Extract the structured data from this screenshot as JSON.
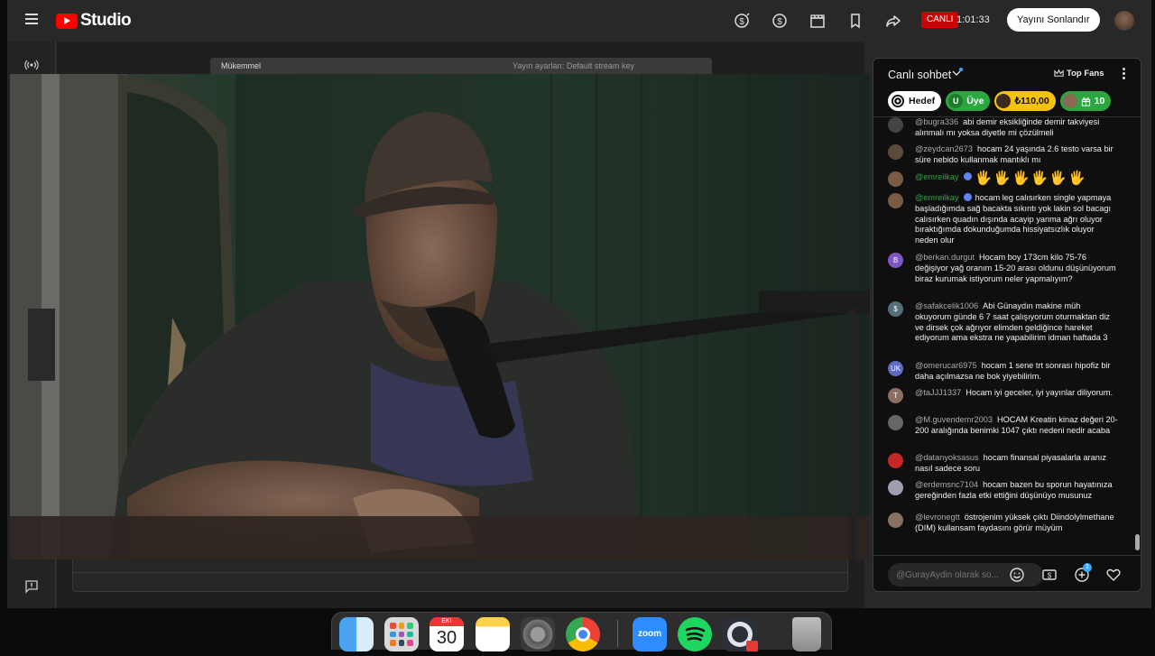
{
  "app": {
    "logo_text": "Studio"
  },
  "topbar": {
    "live_label": "CANLI",
    "live_time": "1:01:33",
    "end_stream_label": "Yayını Sonlandır",
    "icons": [
      "dollar-icon",
      "super-chat-icon",
      "clapperboard-icon",
      "bookmark-icon",
      "share-icon"
    ]
  },
  "preview": {
    "status_text": "Mükemmel",
    "encoder_text": "Yayın ayarları: Default stream key"
  },
  "chat": {
    "title": "Canlı sohbet",
    "top_fans_label": "Top Fans",
    "chips": {
      "goal": "Hedef",
      "member_initial": "U",
      "member": "Üye",
      "supers": "₺110,00",
      "gifts": "10"
    },
    "messages": [
      {
        "author": "@bugra336",
        "text": "abi demir eksikliğinde demir takviyesi alınmalı mı yoksa diyetle mi çözülmeli",
        "avatar": "",
        "avatar_color": "#444444"
      },
      {
        "author": "@zeydcan2673",
        "text": "hocam 24 yaşında 2.6 testo varsa bir süre nebido kullanmak mantıklı mı",
        "avatar": "",
        "avatar_color": "#5a4a3a"
      },
      {
        "author": "@emreilkay",
        "text": "",
        "emoji": "🖐🖐🖐🖐🖐🖐",
        "avatar": "",
        "avatar_color": "#7a5a40",
        "green": true
      },
      {
        "author": "@emreilkay",
        "text": "hocam leg calısırken single yapmaya başladığımda sağ bacakta sıkıntı yok lakin sol bacagı calısırken quadın dışında acayip yanma ağrı oluyor bıraktığımda dokunduğumda hissiyatsızlık oluyor neden olur",
        "avatar": "",
        "avatar_color": "#7a5a40",
        "green": true
      },
      {
        "author": "@berkan.durgut",
        "text": "Hocam boy 173cm kilo 75-76 değişiyor yağ oranım 15-20 arası oldunu düşünüyorum biraz kurumak istiyorum neler yapmalıyım?",
        "avatar": "B",
        "avatar_color": "#7e57c2"
      },
      {
        "author": "@safakcelik1006",
        "text": "Abi Günaydın makine müh okuyorum günde 6 7 saat çalışıyorum oturmaktan diz ve dirsek çok ağrıyor elimden geldiğince hareket ediyorum ama ekstra ne yapabilirim idman haftada 3",
        "avatar": "$",
        "avatar_color": "#546e7a"
      },
      {
        "author": "@omerucar6975",
        "text": "hocam 1 sene trt sonrası hipofiz bir daha açılmazsa ne bok yiyebilirim.",
        "avatar": "UK",
        "avatar_color": "#5c6bc0"
      },
      {
        "author": "@taJJJ1337",
        "text": "Hocam iyi geceler, iyi yayınlar diliyorum.",
        "avatar": "T",
        "avatar_color": "#8d6e63"
      },
      {
        "author": "@M.guvendemr2003",
        "text": "HOCAM Kreatin kinaz değeri 20-200 aralığında benimki 1047 çıktı nedeni nedir acaba",
        "avatar": "",
        "avatar_color": "#666666"
      },
      {
        "author": "@datanyoksasus",
        "text": "hocam finansal piyasalarla aranız nasıl sadece soru",
        "avatar": "",
        "avatar_color": "#c62828"
      },
      {
        "author": "@erdemsnc7104",
        "text": "hocam bazen bu sporun hayatınıza gereğinden fazla etki ettiğini düşünüyo musunuz",
        "avatar": "",
        "avatar_color": "#9e9eae"
      },
      {
        "author": "@levronegtt",
        "text": "östrojenim yüksek çıktı Diindolylmethane (DIM) kullansam faydasını görür müyüm",
        "avatar": "",
        "avatar_color": "#8a7060"
      }
    ],
    "input_placeholder": "@GurayAydin olarak so...",
    "input_badge": "1"
  },
  "dock": {
    "calendar_month": "EKİ",
    "calendar_day": "30",
    "zoom_label": "zoom",
    "apps": [
      "finder",
      "launchpad",
      "calendar",
      "notes",
      "system-settings",
      "chrome",
      "zoom",
      "spotify",
      "obs",
      "trash"
    ]
  }
}
